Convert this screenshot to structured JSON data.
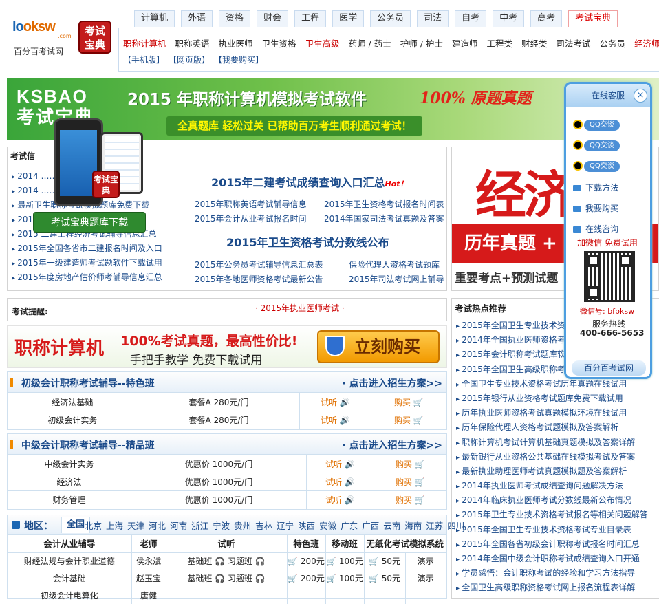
{
  "logo": {
    "brand_a": "lo",
    "brand_b": "oksw",
    "dotcom": ".com",
    "subtitle": "百分百考试网",
    "badge": "考试宝典"
  },
  "top_tabs": [
    "计算机",
    "外语",
    "资格",
    "财会",
    "工程",
    "医学",
    "公务员",
    "司法",
    "自考",
    "中考",
    "高考",
    "考试宝典"
  ],
  "sub_links": [
    "职称计算机",
    "职称英语",
    "执业医师",
    "卫生资格",
    "卫生高级",
    "药师 / 药士",
    "护师 / 护士",
    "建造师",
    "工程类",
    "财经类",
    "司法考试",
    "公务员",
    "经济师"
  ],
  "sub_links2": [
    "【手机版】",
    "【网页版】",
    "【我要购买】"
  ],
  "banner": {
    "brand1": "KSBAO",
    "brand2": "考试宝典",
    "title": "2015 年职称计算机模拟考试软件",
    "slogan_red": "100% 原题真题",
    "slogan": "全真题库 轻松过关 已帮助百万考生顺利通过考试！"
  },
  "promo": {
    "download": "考试宝典题库下载",
    "phone_badge": "考试宝典"
  },
  "news": {
    "header": "考试信",
    "hot": "Hot！",
    "items": [
      "2014 ……汇总",
      "2014 ……系统已开通！",
      "最新卫生职称考试模拟题库免费下载",
      "2015 ……汇总",
      "2015 二建工程经济考试辅导信息汇总",
      "2015年全国各省市二建报名时间及入口",
      "2015年一级建造师考试题软件下载试用",
      "2015年度房地产估价师考辅导信息汇总"
    ],
    "headline1": "2015年二建考试成绩查询入口汇总",
    "headline2": "2015年卫生资格考试分数线公布",
    "mid": [
      "2015年职称英语考试辅导信息",
      "2015年卫生资格考试报名时间表",
      "2015年会计从业考试报名时间",
      "2014年国家司法考试真题及答案",
      "2015年公务员考试辅导信息汇总表",
      "保险代理人资格考试题库",
      "2015年各地医师资格考试最新公告",
      "2015年司法考试网上辅导"
    ]
  },
  "right_ad": {
    "big": "经济",
    "strip": "历年真题 +",
    "bottom": "重要考点+预测试题"
  },
  "reminder": {
    "label": "考试提醒:",
    "text": "· 2015年执业医师考试 ·"
  },
  "ad2": {
    "a": "职称计算机",
    "b": "100%考试真题，最高性价比!",
    "c": "手把手教学 免费下载试用",
    "btn": "立刻购买"
  },
  "course1": {
    "title": "初级会计职称考试辅导--特色班",
    "link": "· 点击进入招生方案>>",
    "rows": [
      [
        "经济法基础",
        "套餐A   280元/门",
        "试听 🔊",
        "购买 🛒"
      ],
      [
        "初级会计实务",
        "套餐A   280元/门",
        "试听 🔊",
        "购买 🛒"
      ]
    ]
  },
  "course2": {
    "title": "中级会计职称考试辅导--精品班",
    "link": "· 点击进入招生方案>>",
    "rows": [
      [
        "中级会计实务",
        "优惠价    1000元/门",
        "试听 🔊",
        "购买 🛒"
      ],
      [
        "经济法",
        "优惠价    1000元/门",
        "试听 🔊",
        "购买 🛒"
      ],
      [
        "财务管理",
        "优惠价    1000元/门",
        "试听 🔊",
        "购买 🛒"
      ]
    ]
  },
  "region": {
    "label": "地区：",
    "all": "全国",
    "cities": [
      "北京",
      "上海",
      "天津",
      "河北",
      "河南",
      "浙江",
      "宁波",
      "贵州",
      "吉林",
      "辽宁",
      "陕西",
      "安徽",
      "广东",
      "广西",
      "云南",
      "海南",
      "江苏",
      "四川"
    ],
    "headers": [
      "会计从业辅导",
      "老师",
      "试听",
      "特色班",
      "移动班",
      "无纸化考试模拟系统"
    ],
    "rows": [
      [
        "财经法规与会计职业道德",
        "侯永斌",
        "基础班 🎧  习题班 🎧",
        "🛒 200元",
        "🛒 100元",
        "🛒 50元",
        "演示"
      ],
      [
        "会计基础",
        "赵玉宝",
        "基础班 🎧  习题班 🎧",
        "🛒 200元",
        "🛒 100元",
        "🛒 50元",
        "演示"
      ],
      [
        "初级会计电算化",
        "唐健",
        "",
        "",
        "",
        "",
        ""
      ]
    ]
  },
  "hot": {
    "header": "考试热点推荐",
    "items": [
      "2015年全国卫生专业技术资格……",
      "2014年全国执业医师资格考试……",
      "2015年会计职称考试题库软件……",
      "2015年全国卫生高级职称考试……",
      "全国卫生专业技术资格考试历年真题在线试用",
      "2015年银行从业资格考试题库免费下载试用",
      "历年执业医师资格考试真题模拟环境在线试用",
      "历年保险代理人资格考试题模拟及答案解析",
      "职称计算机考试计算机基础真题模拟及答案详解",
      "最新银行从业资格公共基础在线模拟考试及答案",
      "最新执业助理医师考试真题模拟题及答案解析",
      "2014年执业医师考试成绩查询问题解决方法",
      "2014年临床执业医师考试分数线最新公布情况",
      "2015年卫生专业技术资格考试报名等相关问题解答",
      "2015年全国卫生专业技术资格考试专业目录表",
      "2015年全国各省初级会计职称考试报名时间汇总",
      "2014年全国中级会计职称考试成绩查询入口开通",
      "学员感悟：会计职称考试的经验和学习方法指导",
      "全国卫生高级职称资格考试网上报名流程表详解"
    ]
  },
  "service": {
    "title": "在线客服",
    "close": "×",
    "qq": "QQ交谈",
    "links": [
      "下载方法",
      "我要购买",
      "在线咨询"
    ],
    "wechat_promo": "加微信 免费试用",
    "wechat": "微信号: bfbksw",
    "hotline_label": "服务热线",
    "hotline": "400-666-5653",
    "footer": "百分百考试网"
  }
}
